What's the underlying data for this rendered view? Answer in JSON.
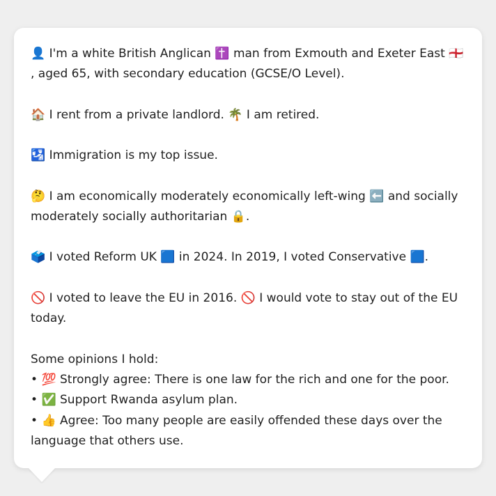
{
  "profile": {
    "intro": {
      "emoji_person": "👤",
      "text_a": " I'm a white British Anglican ",
      "emoji_cross": "✝️",
      "text_b": " man from Exmouth and Exeter East ",
      "emoji_flag": "🏴󠁧󠁢󠁥󠁮󠁧󠁿",
      "text_c": ", aged 65, with secondary education (GCSE/O Level)."
    },
    "housing": {
      "emoji_house": "🏠",
      "text_a": " I rent from a private landlord. ",
      "emoji_palm": "🌴",
      "text_b": " I am retired."
    },
    "issue": {
      "emoji": "🛂",
      "text": " Immigration is my top issue."
    },
    "ideology": {
      "emoji_think": "🤔",
      "text_a": " I am economically moderately economically left-wing ",
      "emoji_left": "⬅️",
      "text_b": " and socially moderately socially authoritarian ",
      "emoji_lock": "🔒",
      "text_c": "."
    },
    "vote": {
      "emoji_ballot": "🗳️",
      "text_a": " I voted Reform UK ",
      "emoji_reform": "🟦",
      "text_b": " in 2024. In 2019, I voted Conservative ",
      "emoji_con": "🟦",
      "text_c": "."
    },
    "eu": {
      "emoji_a": "🚫",
      "text_a": " I voted to leave the EU in 2016. ",
      "emoji_b": "🚫",
      "text_b": " I would vote to stay out of the EU today."
    },
    "opinions_heading": "Some opinions I hold:",
    "opinions": [
      {
        "bullet": "• ",
        "emoji": "💯",
        "text": " Strongly agree: There is one law for the rich and one for the poor."
      },
      {
        "bullet": "• ",
        "emoji": "✅",
        "text": " Support Rwanda asylum plan."
      },
      {
        "bullet": "• ",
        "emoji": "👍",
        "text": " Agree: Too many people are easily offended these days over the language that others use."
      }
    ]
  }
}
